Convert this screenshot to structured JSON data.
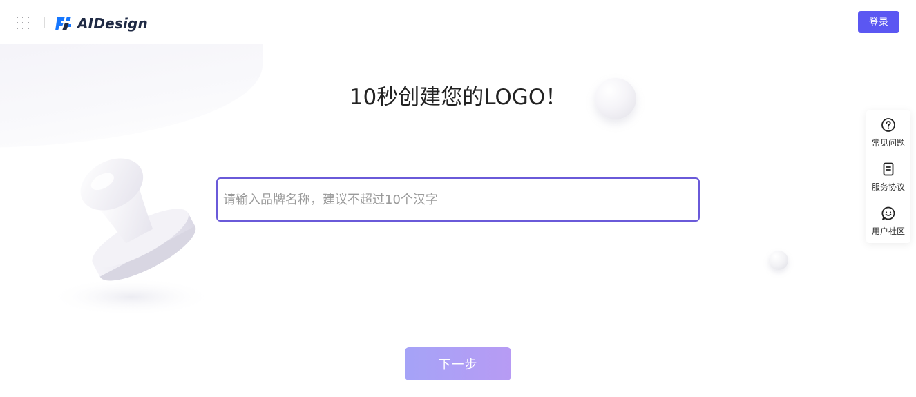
{
  "header": {
    "app_name": "AIDesign",
    "login_label": "登录",
    "grid_icon": "grid-icon",
    "logo_icon": "aidesign-logo-icon",
    "brand_color": "#5b57f2"
  },
  "main": {
    "title": "10秒创建您的LOGO！",
    "brand_input": {
      "value": "",
      "placeholder": "请输入品牌名称，建议不超过10个汉字"
    },
    "next_label": "下一步"
  },
  "side_panel": {
    "items": [
      {
        "label": "常见问题",
        "icon": "question-circle-icon"
      },
      {
        "label": "服务协议",
        "icon": "document-icon"
      },
      {
        "label": "用户社区",
        "icon": "smiley-chat-icon"
      }
    ]
  },
  "colors": {
    "input_border": "#6a5ad9",
    "next_gradient_start": "#a5a3f7",
    "next_gradient_end": "#b79bf4"
  }
}
